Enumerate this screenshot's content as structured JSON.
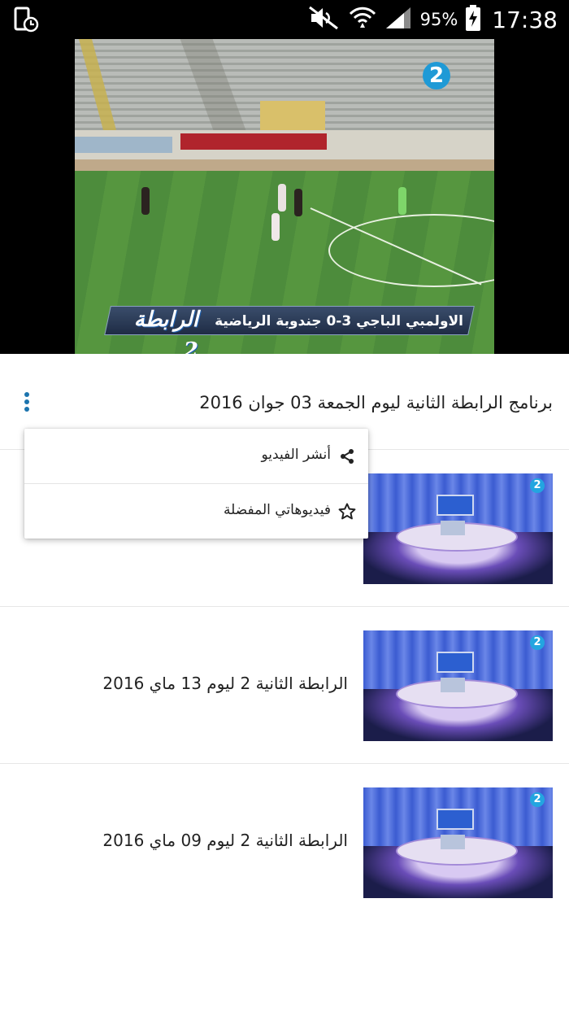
{
  "status_bar": {
    "battery_percent": "95%",
    "time": "17:38",
    "icons": [
      "screen-timer-icon",
      "mute-icon",
      "wifi-icon",
      "signal-icon",
      "battery-charging-icon"
    ]
  },
  "video": {
    "channel_logo": "2",
    "ticker_text": "الاولمبي الباجي 3-0 جندوبة الرياضية",
    "ticker_brand": "الرابطة 2"
  },
  "current_video": {
    "title": "برنامج الرابطة الثانية ليوم الجمعة 03 جوان 2016",
    "menu_icon": "more-vert-icon"
  },
  "popup_menu": {
    "items": [
      {
        "label": "أنشر الفيديو",
        "icon": "share-icon"
      },
      {
        "label": "فيديوهاتي المفضلة",
        "icon": "star-outline-icon"
      }
    ]
  },
  "video_list": {
    "items": [
      {
        "title": ""
      },
      {
        "title": "الرابطة الثانية  2 ليوم 13 ماي 2016"
      },
      {
        "title": "الرابطة الثانية  2 ليوم 09  ماي 2016"
      }
    ]
  },
  "colors": {
    "accent": "#1c74ae",
    "status_bar_bg": "#000000"
  }
}
